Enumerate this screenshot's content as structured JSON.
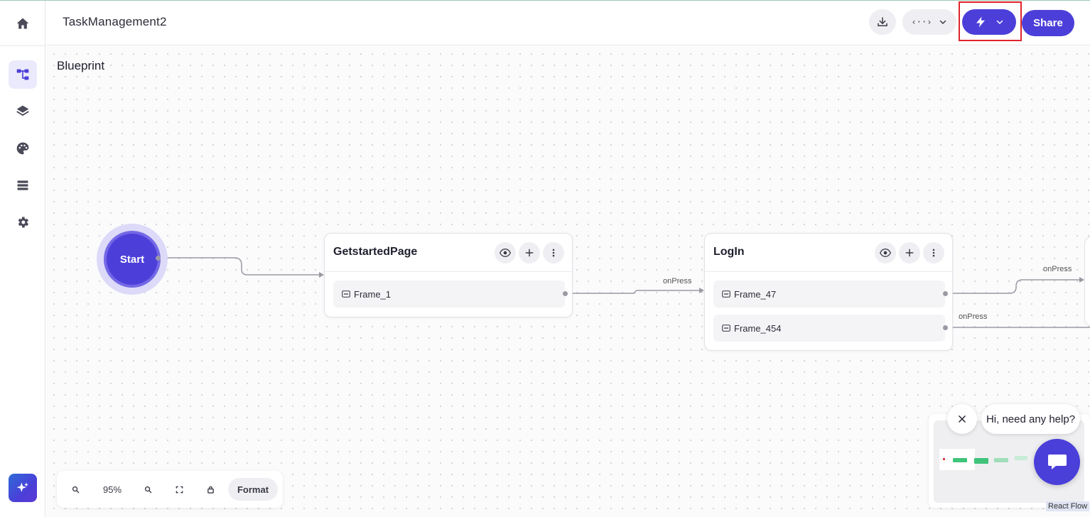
{
  "header": {
    "title": "TaskManagement2",
    "download_icon": "download-icon",
    "code_button_glyph": "‹··›",
    "run_icon": "lightning-icon",
    "share_label": "Share"
  },
  "sidebar": {
    "items": [
      {
        "name": "home",
        "icon": "home-icon"
      },
      {
        "name": "blueprint",
        "icon": "flow-icon",
        "active": true
      },
      {
        "name": "layers",
        "icon": "layers-icon"
      },
      {
        "name": "theme",
        "icon": "palette-icon"
      },
      {
        "name": "data",
        "icon": "list-icon"
      },
      {
        "name": "settings",
        "icon": "gear-icon"
      },
      {
        "name": "ai-assistant",
        "icon": "sparkle-icon"
      }
    ]
  },
  "canvas": {
    "heading": "Blueprint",
    "start_label": "Start",
    "nodes": [
      {
        "title": "GetstartedPage",
        "frames": [
          "Frame_1"
        ]
      },
      {
        "title": "LogIn",
        "frames": [
          "Frame_47",
          "Frame_454"
        ]
      }
    ],
    "edge_labels": [
      "onPress",
      "onPress",
      "onPress"
    ]
  },
  "controls": {
    "zoom_level": "95%",
    "format_label": "Format"
  },
  "minimap": {
    "attribution": "React Flow"
  },
  "help": {
    "message": "Hi, need any help?"
  },
  "colors": {
    "accent": "#4c3fd9",
    "highlight_box": "#e0242c",
    "minimap_node": "#3fc47a"
  }
}
